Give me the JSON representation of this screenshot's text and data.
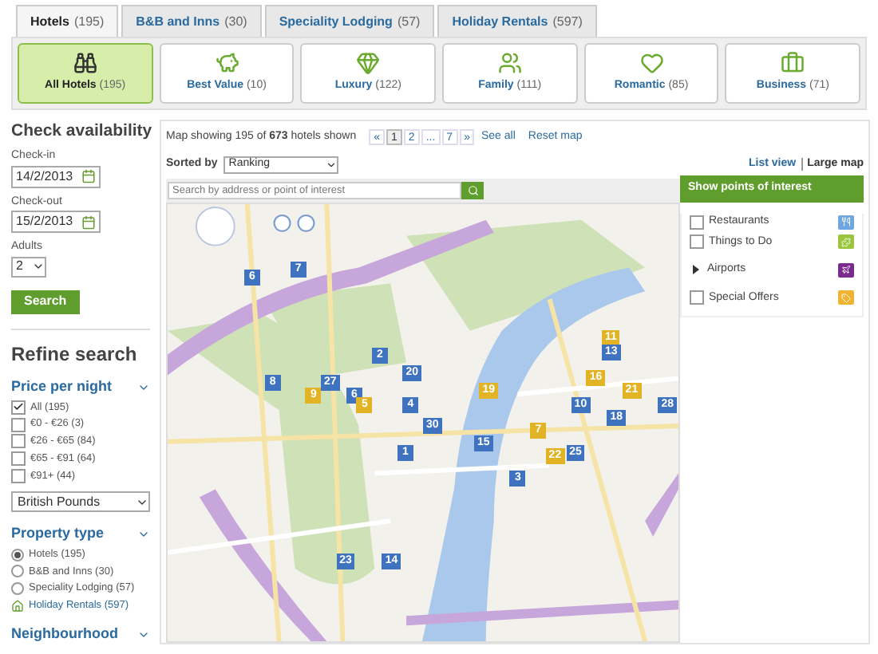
{
  "tabs": [
    {
      "label": "Hotels",
      "count": "(195)",
      "selected": true
    },
    {
      "label": "B&B and Inns",
      "count": "(30)",
      "selected": false
    },
    {
      "label": "Speciality Lodging",
      "count": "(57)",
      "selected": false
    },
    {
      "label": "Holiday Rentals",
      "count": "(597)",
      "selected": false
    }
  ],
  "categories": [
    {
      "label": "All Hotels",
      "count": "(195)",
      "selected": true
    },
    {
      "label": "Best Value",
      "count": "(10)",
      "selected": false
    },
    {
      "label": "Luxury",
      "count": "(122)",
      "selected": false
    },
    {
      "label": "Family",
      "count": "(111)",
      "selected": false
    },
    {
      "label": "Romantic",
      "count": "(85)",
      "selected": false
    },
    {
      "label": "Business",
      "count": "(71)",
      "selected": false
    }
  ],
  "availability": {
    "title": "Check availability",
    "checkin_label": "Check-in",
    "checkin": "14/2/2013",
    "checkout_label": "Check-out",
    "checkout": "15/2/2013",
    "adults_label": "Adults",
    "adults": "2",
    "search_button": "Search"
  },
  "refine": {
    "title": "Refine search",
    "price": {
      "title": "Price per night",
      "currency": "British Pounds",
      "options": [
        {
          "label": "All (195)",
          "checked": true
        },
        {
          "label": "€0 - €26 (3)",
          "checked": false
        },
        {
          "label": "€26 - €65 (84)",
          "checked": false
        },
        {
          "label": "€65 - €91 (64)",
          "checked": false
        },
        {
          "label": "€91+ (44)",
          "checked": false
        }
      ]
    },
    "property": {
      "title": "Property type",
      "options": [
        {
          "kind": "radio",
          "label": "Hotels (195)",
          "selected": true
        },
        {
          "kind": "radio",
          "label": "B&B and Inns (30)",
          "selected": false
        },
        {
          "kind": "radio",
          "label": "Speciality Lodging (57)",
          "selected": false
        },
        {
          "kind": "link",
          "label": "Holiday Rentals (597)"
        }
      ]
    },
    "neighbourhood": {
      "title": "Neighbourhood"
    }
  },
  "map_header": {
    "summary": "Map showing 195 of **673** hotels shown",
    "pages": [
      {
        "label": "«",
        "selected": false
      },
      {
        "label": "1",
        "selected": true
      },
      {
        "label": "2",
        "selected": false
      },
      {
        "label": "...",
        "selected": false
      },
      {
        "label": "7",
        "selected": false
      },
      {
        "label": "»",
        "selected": false
      }
    ],
    "see_all": "See all",
    "reset": "Reset map"
  },
  "sort": {
    "label": "Sorted by",
    "value": "Ranking"
  },
  "views": [
    {
      "label": "List view",
      "selected": false
    },
    {
      "label": "Large map",
      "selected": true
    }
  ],
  "map_search": {
    "placeholder": "Search by address or point of interest"
  },
  "markers": [
    {
      "label": "6",
      "color": "#3f73c0"
    },
    {
      "label": "7",
      "color": "#3f73c0"
    },
    {
      "label": "8",
      "color": "#3f73c0"
    },
    {
      "label": "2",
      "color": "#3f73c0"
    },
    {
      "label": "27",
      "color": "#3f73c0"
    },
    {
      "label": "9",
      "color": "#e2b324"
    },
    {
      "label": "6",
      "color": "#3f73c0"
    },
    {
      "label": "5",
      "color": "#e2b324"
    },
    {
      "label": "20",
      "color": "#3f73c0"
    },
    {
      "label": "4",
      "color": "#3f73c0"
    },
    {
      "label": "30",
      "color": "#3f73c0"
    },
    {
      "label": "1",
      "color": "#3f73c0"
    },
    {
      "label": "15",
      "color": "#3f73c0"
    },
    {
      "label": "19",
      "color": "#e2b324"
    },
    {
      "label": "3",
      "color": "#3f73c0"
    },
    {
      "label": "7",
      "color": "#e2b324"
    },
    {
      "label": "22",
      "color": "#e2b324"
    },
    {
      "label": "25",
      "color": "#3f73c0"
    },
    {
      "label": "10",
      "color": "#3f73c0"
    },
    {
      "label": "18",
      "color": "#3f73c0"
    },
    {
      "label": "16",
      "color": "#e2b324"
    },
    {
      "label": "21",
      "color": "#e2b324"
    },
    {
      "label": "28",
      "color": "#3f73c0"
    },
    {
      "label": "11",
      "color": "#e2b324"
    },
    {
      "label": "13",
      "color": "#3f73c0"
    },
    {
      "label": "23",
      "color": "#3f73c0"
    },
    {
      "label": "14",
      "color": "#3f73c0"
    }
  ],
  "poi": {
    "title": "Show points of interest",
    "items": [
      {
        "kind": "checkbox",
        "label": "Restaurants",
        "checked": false,
        "color": "#6ea6e0"
      },
      {
        "kind": "checkbox",
        "label": "Things to Do",
        "checked": false,
        "color": "#9bc53d"
      },
      {
        "kind": "expander",
        "label": "Airports",
        "expanded": false,
        "color": "#7b2a8e"
      },
      {
        "kind": "checkbox",
        "label": "Special Offers",
        "checked": false,
        "color": "#f0b430"
      }
    ]
  }
}
